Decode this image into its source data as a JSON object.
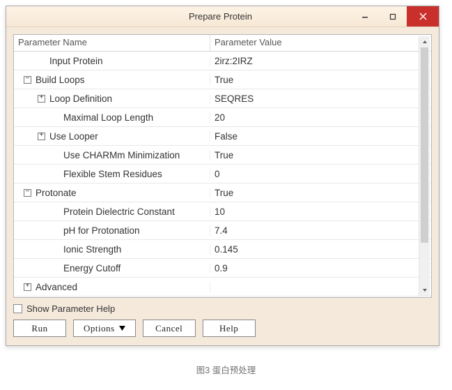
{
  "window": {
    "title": "Prepare Protein"
  },
  "headers": {
    "name": "Parameter Name",
    "value": "Parameter Value"
  },
  "rows": [
    {
      "indent": 1,
      "toggle": "",
      "name": "Input Protein",
      "value": "2irz:2IRZ"
    },
    {
      "indent": 0,
      "toggle": "−",
      "name": "Build Loops",
      "value": "True"
    },
    {
      "indent": 1,
      "toggle": "+",
      "name": "Loop Definition",
      "value": "SEQRES"
    },
    {
      "indent": 2,
      "toggle": "",
      "name": "Maximal Loop Length",
      "value": "20"
    },
    {
      "indent": 1,
      "toggle": "+",
      "name": "Use Looper",
      "value": "False"
    },
    {
      "indent": 2,
      "toggle": "",
      "name": "Use CHARMm Minimization",
      "value": "True"
    },
    {
      "indent": 2,
      "toggle": "",
      "name": "Flexible Stem Residues",
      "value": "0"
    },
    {
      "indent": 0,
      "toggle": "−",
      "name": "Protonate",
      "value": "True"
    },
    {
      "indent": 2,
      "toggle": "",
      "name": "Protein Dielectric Constant",
      "value": "10"
    },
    {
      "indent": 2,
      "toggle": "",
      "name": "pH for Protonation",
      "value": "7.4"
    },
    {
      "indent": 2,
      "toggle": "",
      "name": "Ionic Strength",
      "value": "0.145"
    },
    {
      "indent": 2,
      "toggle": "",
      "name": "Energy Cutoff",
      "value": "0.9"
    },
    {
      "indent": 0,
      "toggle": "+",
      "name": "Advanced",
      "value": ""
    }
  ],
  "help_checkbox_label": "Show Parameter Help",
  "buttons": {
    "run": "Run",
    "options": "Options",
    "cancel": "Cancel",
    "help": "Help"
  },
  "caption": "图3 蛋白预处理"
}
